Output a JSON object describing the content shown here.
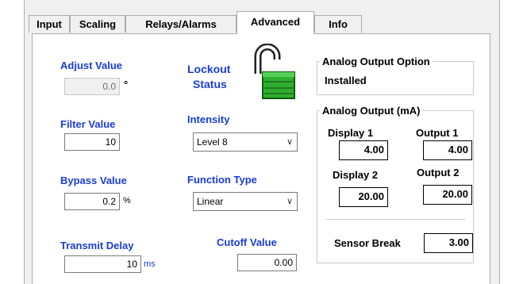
{
  "tabs": [
    {
      "label": "Input"
    },
    {
      "label": "Scaling"
    },
    {
      "label": "Relays/Alarms"
    },
    {
      "label": "Advanced",
      "active": true
    },
    {
      "label": "Info"
    }
  ],
  "adjust": {
    "label": "Adjust Value",
    "value": "0.0",
    "unit": "°",
    "disabled": true
  },
  "filter": {
    "label": "Filter Value",
    "value": "10"
  },
  "bypass": {
    "label": "Bypass Value",
    "value": "0.2",
    "unit": "%"
  },
  "transmit": {
    "label": "Transmit Delay",
    "value": "10",
    "unit": "ms"
  },
  "lockout": {
    "label_line1": "Lockout",
    "label_line2": "Status",
    "icon": "unlocked-padlock-icon",
    "state": "unlocked"
  },
  "intensity": {
    "label": "Intensity",
    "selected": "Level 8"
  },
  "function_type": {
    "label": "Function Type",
    "selected": "Linear"
  },
  "cutoff": {
    "label": "Cutoff Value",
    "value": "0.00"
  },
  "analog_option": {
    "title": "Analog Output Option",
    "status": "Installed"
  },
  "analog_output": {
    "title": "Analog Output (mA)",
    "display1_label": "Display 1",
    "display1_value": "4.00",
    "output1_label": "Output 1",
    "output1_value": "4.00",
    "display2_label": "Display 2",
    "display2_value": "20.00",
    "output2_label": "Output 2",
    "output2_value": "20.00",
    "sensor_break_label": "Sensor Break",
    "sensor_break_value": "3.00"
  },
  "colors": {
    "label_blue": "#1a3cd6",
    "lock_green": "#2fae2f"
  }
}
